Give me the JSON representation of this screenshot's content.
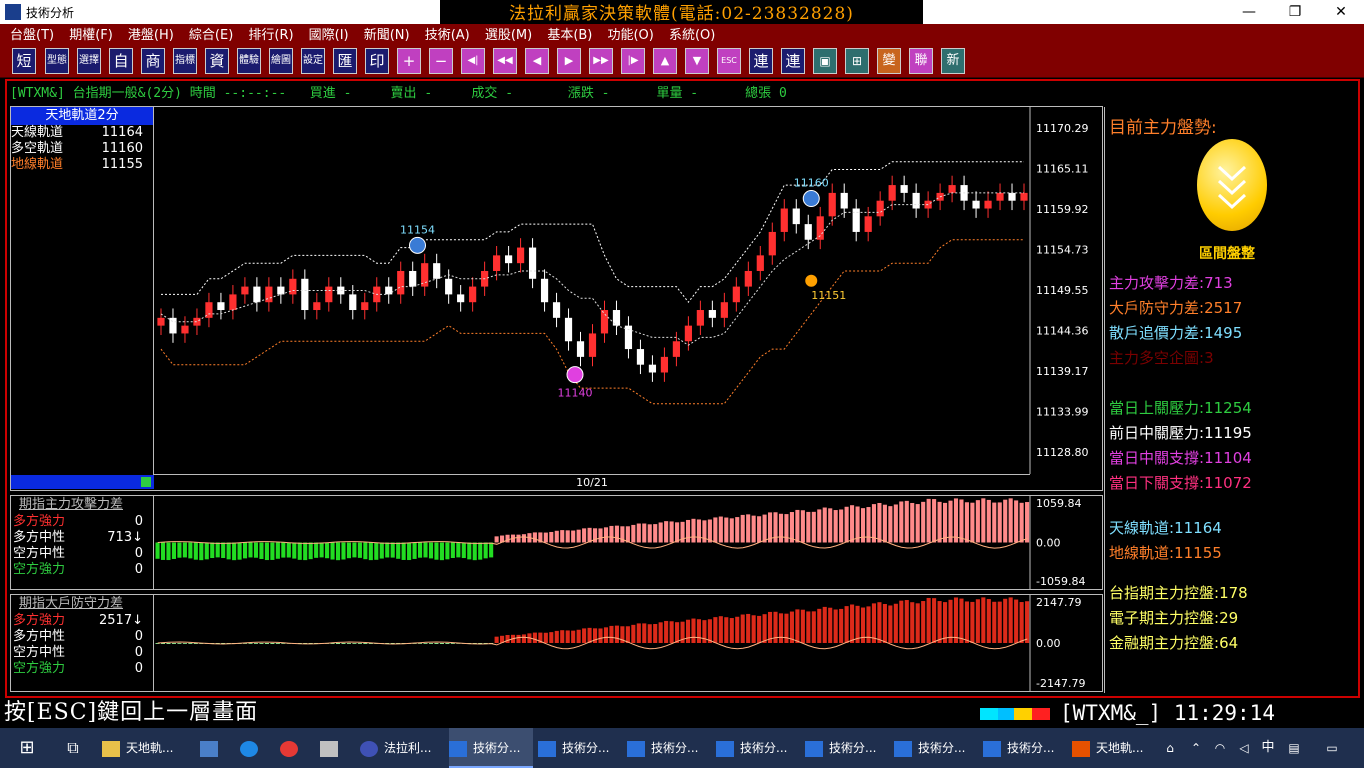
{
  "window": {
    "title": "技術分析",
    "banner": "法拉利贏家決策軟體(電話:02-23832828)",
    "minimize": "—",
    "restore": "❐",
    "close": "✕"
  },
  "menu": [
    "台盤(T)",
    "期權(F)",
    "港盤(H)",
    "綜合(E)",
    "排行(R)",
    "國際(I)",
    "新聞(N)",
    "技術(A)",
    "選股(M)",
    "基本(B)",
    "功能(O)",
    "系統(O)"
  ],
  "toolbar": {
    "text_buttons": [
      "短",
      "型態",
      "選擇",
      "自",
      "商",
      "指標",
      "資",
      "體驗",
      "繪圖",
      "設定",
      "匯",
      "印"
    ],
    "nav_buttons": [
      "+",
      "−",
      "◀|",
      "◀◀",
      "◀",
      "▶",
      "▶▶",
      "|▶",
      "▲",
      "▼",
      "ESC"
    ],
    "tail_buttons": [
      "連",
      "連",
      "▣",
      "⊞",
      "變",
      "聯",
      "新"
    ]
  },
  "status": {
    "symbol": "[WTXM&]",
    "name": "台指期一般&(2分)",
    "time_label": "時間",
    "time_value": "--:--:--",
    "buy_label": "買進",
    "buy_value": "-",
    "sell_label": "賣出",
    "sell_value": "-",
    "trade_label": "成交",
    "trade_value": "-",
    "change_label": "漲跌",
    "change_value": "-",
    "vol_label": "單量",
    "vol_value": "-",
    "total_label": "總張",
    "total_value": "0"
  },
  "legend_main": {
    "header": "天地軌道2分",
    "rows": [
      {
        "label": "天線軌道",
        "value": "11164",
        "color": "#ffffff"
      },
      {
        "label": "多空軌道",
        "value": "11160",
        "color": "#ffffff"
      },
      {
        "label": "地線軌道",
        "value": "11155",
        "color": "#ff7f2a"
      }
    ]
  },
  "legend_attack": {
    "header": "期指主力攻擊力差",
    "rows": [
      {
        "label": "多方強力",
        "value": "0",
        "color": "#ff3030"
      },
      {
        "label": "多方中性",
        "value": "713↓",
        "color": "#ffffff"
      },
      {
        "label": "空方中性",
        "value": "0",
        "color": "#ffffff"
      },
      {
        "label": "空方強力",
        "value": "0",
        "color": "#2ecc40"
      }
    ]
  },
  "legend_defense": {
    "header": "期指大戶防守力差",
    "rows": [
      {
        "label": "多方強力",
        "value": "2517↓",
        "color": "#ff3030"
      },
      {
        "label": "多方中性",
        "value": "0",
        "color": "#ffffff"
      },
      {
        "label": "空方中性",
        "value": "0",
        "color": "#ffffff"
      },
      {
        "label": "空方強力",
        "value": "0",
        "color": "#2ecc40"
      }
    ]
  },
  "right_panel": {
    "trend_title": "目前主力盤勢:",
    "trend_state": "區間盤整",
    "metrics": [
      {
        "label": "主力攻擊力差",
        "value": "713",
        "color": "#e040e0"
      },
      {
        "label": "大戶防守力差",
        "value": "2517",
        "color": "#ff7f2a"
      },
      {
        "label": "散戶追價力差",
        "value": "1495",
        "color": "#7fdfff"
      },
      {
        "label": "主力多空企圖",
        "value": "3",
        "color": "#7a0000"
      }
    ],
    "levels": [
      {
        "label": "當日上關壓力",
        "value": "11254",
        "color": "#2ecc40"
      },
      {
        "label": "前日中關壓力",
        "value": "11195",
        "color": "#ffffff"
      },
      {
        "label": "當日中關支撐",
        "value": "11104",
        "color": "#e040e0"
      },
      {
        "label": "當日下關支撐",
        "value": "11072",
        "color": "#ff3080"
      }
    ],
    "tracks": [
      {
        "label": "天線軌道",
        "value": "11164",
        "color": "#7fdfff"
      },
      {
        "label": "地線軌道",
        "value": "11155",
        "color": "#ff7f2a"
      }
    ],
    "control": [
      {
        "label": "台指期主力控盤",
        "value": "178",
        "color": "#ffff66"
      },
      {
        "label": "電子期主力控盤",
        "value": "29",
        "color": "#ffff66"
      },
      {
        "label": "金融期主力控盤",
        "value": "64",
        "color": "#ffff66"
      }
    ]
  },
  "chart_data": [
    {
      "type": "candlestick",
      "title": "天地軌道2分",
      "y_ticks": [
        "11170.29",
        "11165.11",
        "11159.92",
        "11154.73",
        "11149.55",
        "11144.36",
        "11139.17",
        "11133.99",
        "11128.80"
      ],
      "ylim": [
        11126,
        11173
      ],
      "x_label": "10/21",
      "markers": [
        {
          "label": "11154",
          "type": "sell",
          "color": "#7fdfff"
        },
        {
          "label": "11140",
          "type": "buy",
          "color": "#e040e0"
        },
        {
          "label": "11160",
          "type": "sell",
          "color": "#7fdfff"
        },
        {
          "label": "11151",
          "type": "dot",
          "color": "#ffcc33"
        }
      ],
      "ohlc_close": [
        11146,
        11144,
        11145,
        11146,
        11148,
        11147,
        11149,
        11150,
        11148,
        11150,
        11149,
        11151,
        11147,
        11148,
        11150,
        11149,
        11147,
        11148,
        11150,
        11149,
        11152,
        11150,
        11153,
        11151,
        11149,
        11148,
        11150,
        11152,
        11154,
        11153,
        11155,
        11151,
        11148,
        11146,
        11143,
        11141,
        11144,
        11147,
        11145,
        11142,
        11140,
        11139,
        11141,
        11143,
        11145,
        11147,
        11146,
        11148,
        11150,
        11152,
        11154,
        11157,
        11160,
        11158,
        11156,
        11159,
        11162,
        11160,
        11157,
        11159,
        11161,
        11163,
        11162,
        11160,
        11161,
        11162,
        11163,
        11161,
        11160,
        11161,
        11162,
        11161,
        11162
      ]
    },
    {
      "type": "bar",
      "title": "期指主力攻擊力差",
      "y_ticks": [
        "1059.84",
        "0.00",
        "-1059.84"
      ],
      "ylim": [
        -1150,
        1150
      ]
    },
    {
      "type": "bar",
      "title": "期指大戶防守力差",
      "y_ticks": [
        "2147.79",
        "0.00",
        "-2147.79"
      ],
      "ylim": [
        -2300,
        2300
      ]
    }
  ],
  "bottom": {
    "esc_hint": "按[ESC]鍵回上一層畫面",
    "symbol": "[WTXM&_]",
    "clock": "11:29:14"
  },
  "taskbar": {
    "items": [
      "天地軌...",
      "法拉利...",
      "技術分...",
      "技術分...",
      "技術分...",
      "技術分...",
      "技術分...",
      "技術分...",
      "技術分...",
      "天地軌..."
    ],
    "ime": "中"
  }
}
